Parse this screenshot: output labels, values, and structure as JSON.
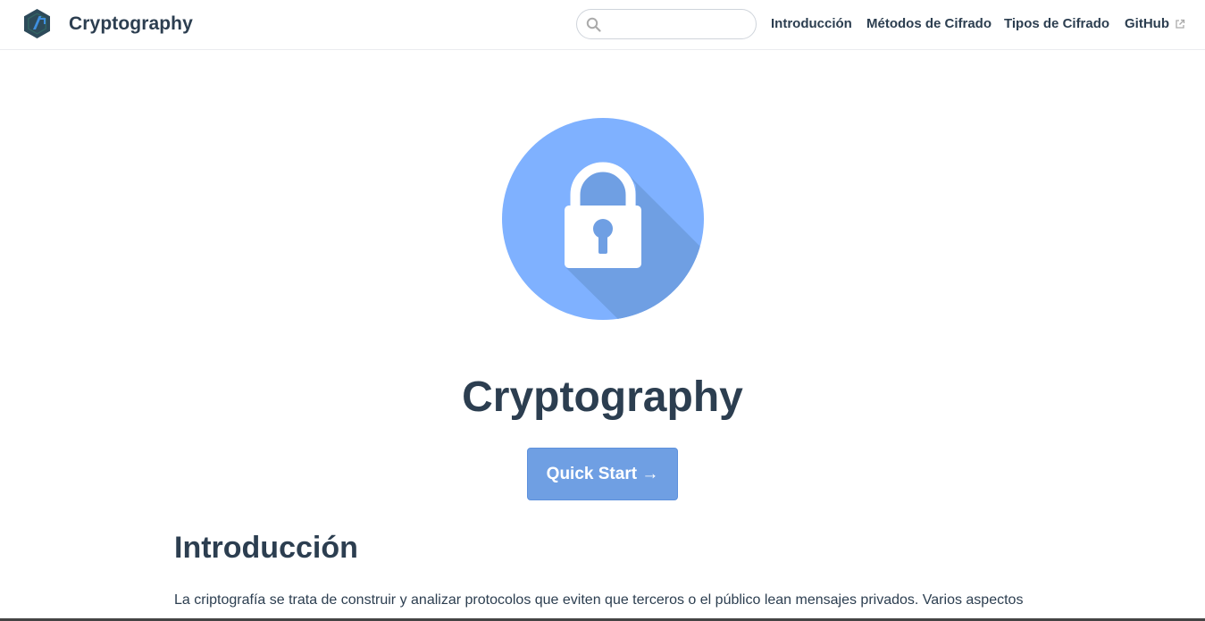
{
  "header": {
    "site_name": "Cryptography",
    "logo": "hexagon-logo-icon",
    "search": {
      "value": "",
      "placeholder": "",
      "icon": "search-icon"
    },
    "nav": [
      {
        "label": "Introducción"
      },
      {
        "label": "Métodos de Cifrado"
      },
      {
        "label": "Tipos de Cifrado"
      },
      {
        "label": "GitHub",
        "icon": "external-link-icon"
      }
    ]
  },
  "hero": {
    "image": "padlock-icon",
    "title": "Cryptography",
    "cta_label": "Quick Start →"
  },
  "content": {
    "section_title": "Introducción",
    "paragraph": "La criptografía se trata de construir y analizar protocolos que eviten que terceros o el público lean mensajes privados. Varios aspectos"
  },
  "colors": {
    "text": "#2c3e50",
    "accent": "#6f9fe3",
    "hero_circle": "#7fb1ff",
    "hero_shadow": "#6f9fe3"
  }
}
